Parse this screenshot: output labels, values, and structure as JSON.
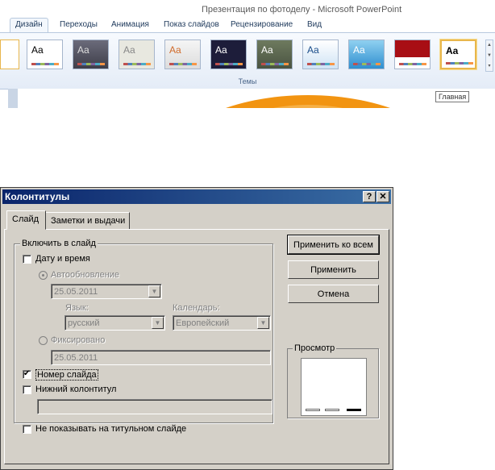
{
  "ppt": {
    "window_title": "Презентация по фотоделу - Microsoft PowerPoint",
    "tabs": [
      "Дизайн",
      "Переходы",
      "Анимация",
      "Показ слайдов",
      "Рецензирование",
      "Вид"
    ],
    "themes_group_label": "Темы",
    "theme_text": "Aa",
    "tooltip": "Главная"
  },
  "dialog": {
    "title": "Колонтитулы",
    "help_btn": "?",
    "close_btn": "✕",
    "tabs": [
      "Слайд",
      "Заметки и выдачи"
    ],
    "include_group": "Включить в слайд",
    "date_time": "Дату и время",
    "auto_update": "Автообновление",
    "auto_date": "25.05.2011",
    "language_label": "Язык:",
    "language_value": "русский",
    "calendar_label": "Календарь:",
    "calendar_value": "Европейский",
    "fixed": "Фиксировано",
    "fixed_date": "25.05.2011",
    "slide_number": "Номер слайда",
    "footer": "Нижний колонтитул",
    "footer_value": "",
    "dont_show_title": "Не показывать на титульном слайде",
    "apply_all": "Применить ко всем",
    "apply": "Применить",
    "cancel": "Отмена",
    "preview": "Просмотр",
    "state": {
      "date_time": false,
      "slide_number": true,
      "footer": false,
      "dont_show_title": false,
      "auto_update_selected": true
    }
  },
  "colors": {
    "title_bar": "#0a246a",
    "dialog_face": "#d4d0c8",
    "ribbon_text": "#1e395b",
    "accent_orange": "#f29411"
  }
}
